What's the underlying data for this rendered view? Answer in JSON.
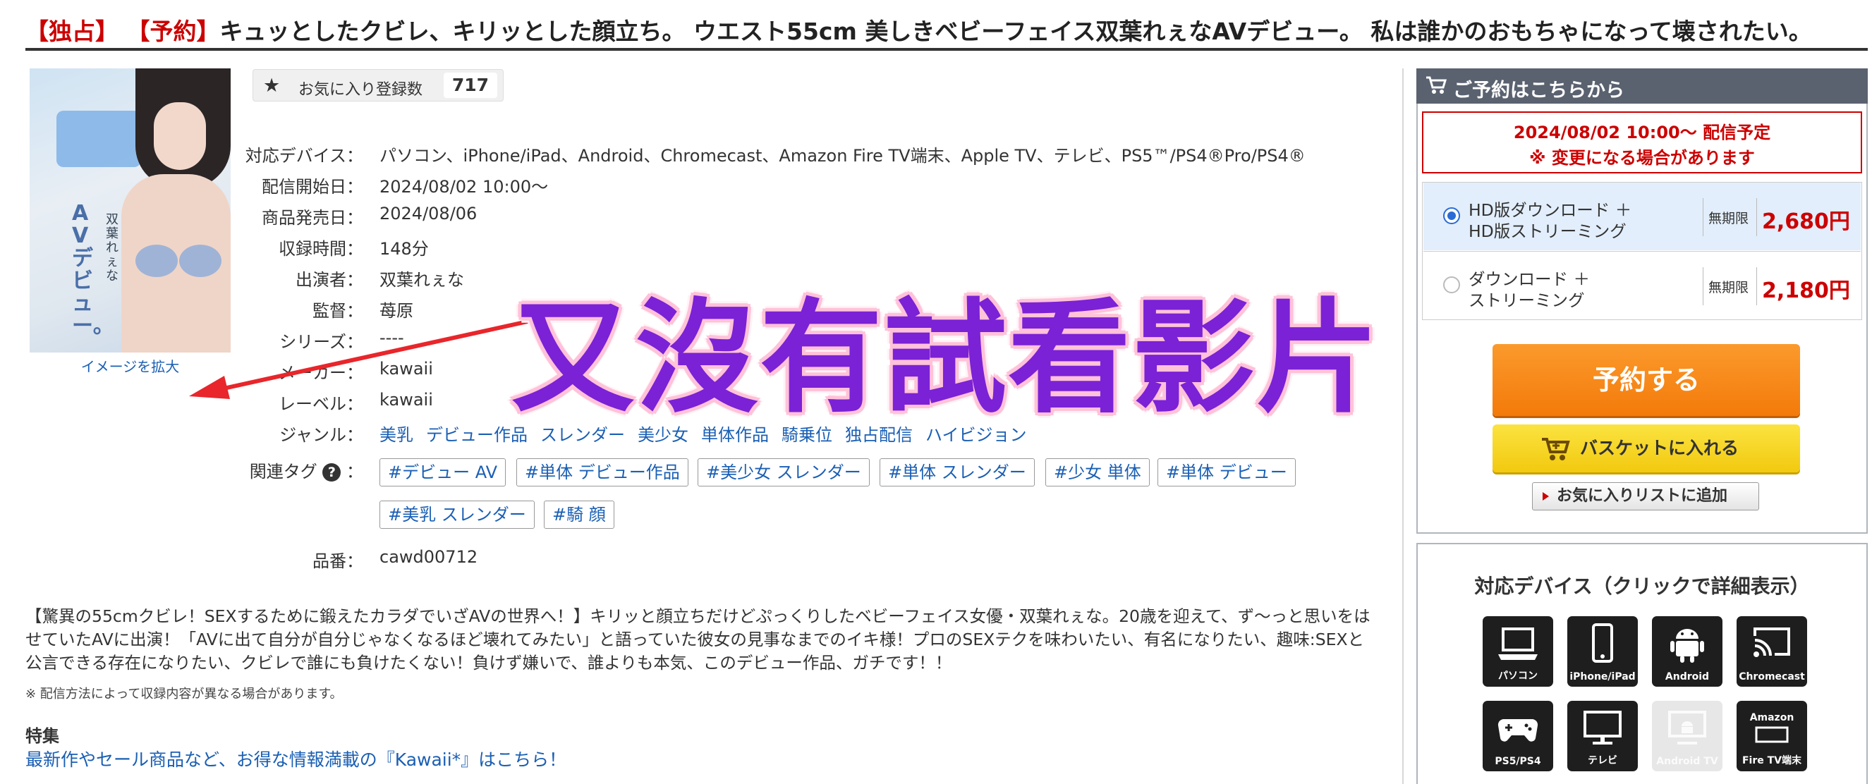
{
  "title": {
    "exclusive_tag": "【独占】",
    "preorder_tag": "【予約】",
    "text": "キュッとしたクビレ、キリッとした顔立ち。 ウエスト55cm 美しきベビーフェイス双葉れぇなAVデビュー。 私は誰かのおもちゃになって壊されたい。"
  },
  "cover": {
    "enlarge_label": "イメージを拡大",
    "cover_text_large": "AVデビュー。",
    "cover_text_small": "双葉れぇな"
  },
  "favorites": {
    "icon": "star-icon",
    "label": "お気に入り登録数",
    "count": "717"
  },
  "info": {
    "devices_label": "対応デバイス：",
    "devices_value": "パソコン、iPhone/iPad、Android、Chromecast、Amazon Fire TV端末、Apple TV、テレビ、PS5™/PS4®Pro/PS4®",
    "release_label": "配信開始日：",
    "release_value": "2024/08/02 10:00〜",
    "sale_label": "商品発売日：",
    "sale_value": "2024/08/06",
    "duration_label": "収録時間：",
    "duration_value": "148分",
    "performer_label": "出演者：",
    "performer_value": "双葉れぇな",
    "director_label": "監督：",
    "director_value": "苺原",
    "series_label": "シリーズ：",
    "series_value": "----",
    "maker_label": "メーカー：",
    "maker_value": "kawaii",
    "label_label": "レーベル：",
    "label_value": "kawaii",
    "genre_label": "ジャンル：",
    "genres": [
      "美乳",
      "デビュー作品",
      "スレンダー",
      "美少女",
      "単体作品",
      "騎乗位",
      "独占配信",
      "ハイビジョン"
    ],
    "tags_label": "関連タグ",
    "tags_help": "?",
    "tags_colon": "：",
    "tags": [
      "#デビュー AV",
      "#単体 デビュー作品",
      "#美少女 スレンダー",
      "#単体 スレンダー",
      "#少女 単体",
      "#単体 デビュー",
      "#美乳 スレンダー",
      "#騎 顔"
    ],
    "code_label": "品番：",
    "code_value": "cawd00712"
  },
  "description": {
    "body": "【驚異の55cmクビレ！SEXするために鍛えたカラダでいざAVの世界へ！】キリッと顔立ちだけどぷっくりしたベビーフェイス女優・双葉れぇな。20歳を迎えて、ず〜っと思いをはせていたAVに出演！「AVに出て自分が自分じゃなくなるほど壊れてみたい」と語っていた彼女の見事なまでのイキ様！プロのSEXテクを味わいたい、有名になりたい、趣味:SEXと公言できる存在になりたい、クビレで誰にも負けたくない！負けず嫌いで、誰よりも本気、このデビュー作品、ガチです！！",
    "note": "※ 配信方法によって収録内容が異なる場合があります。",
    "feature_heading": "特集",
    "feature_link": "最新作やセール商品など、お得な情報満載の『Kawaii*』はこちら！"
  },
  "sidebar": {
    "header": "ご予約はこちらから",
    "header_icon": "cart-icon",
    "notice_line1": "2024/08/02 10:00〜 配信予定",
    "notice_line2": "※ 変更になる場合があります",
    "options": [
      {
        "line1": "HD版ダウンロード ＋",
        "line2": "HD版ストリーミング",
        "period": "無期限",
        "price": "2,680円",
        "selected": true
      },
      {
        "line1": "ダウンロード ＋",
        "line2": "ストリーミング",
        "period": "無期限",
        "price": "2,180円",
        "selected": false
      }
    ],
    "reserve_button": "予約する",
    "basket_button": "バスケットに入れる",
    "wishlist_button": "お気に入りリストに追加",
    "devices_title": "対応デバイス（クリックで詳細表示）",
    "devices": [
      {
        "icon": "laptop-icon",
        "label": "パソコン",
        "available": true
      },
      {
        "icon": "smartphone-icon",
        "label": "iPhone/iPad",
        "available": true
      },
      {
        "icon": "android-icon",
        "label": "Android",
        "available": true
      },
      {
        "icon": "chromecast-icon",
        "label": "Chromecast",
        "available": true
      },
      {
        "icon": "gamepad-icon",
        "label": "PS5/PS4",
        "available": true
      },
      {
        "icon": "tv-icon",
        "label": "テレビ",
        "available": true
      },
      {
        "icon": "android-tv-icon",
        "label": "Android TV",
        "available": false
      },
      {
        "icon": "fire-tv-icon",
        "label": "Fire TV端末",
        "available": true,
        "brand": "Amazon"
      }
    ]
  },
  "overlay": {
    "text": "又沒有試看影片",
    "color": "#7b21d6",
    "arrow_color": "#e8262b"
  },
  "colors": {
    "link": "#1a5fb4",
    "accent_red": "#cc0000",
    "reserve_orange": "#f37a0a",
    "basket_yellow": "#f2c90f",
    "sidebar_header": "#5a6270"
  }
}
